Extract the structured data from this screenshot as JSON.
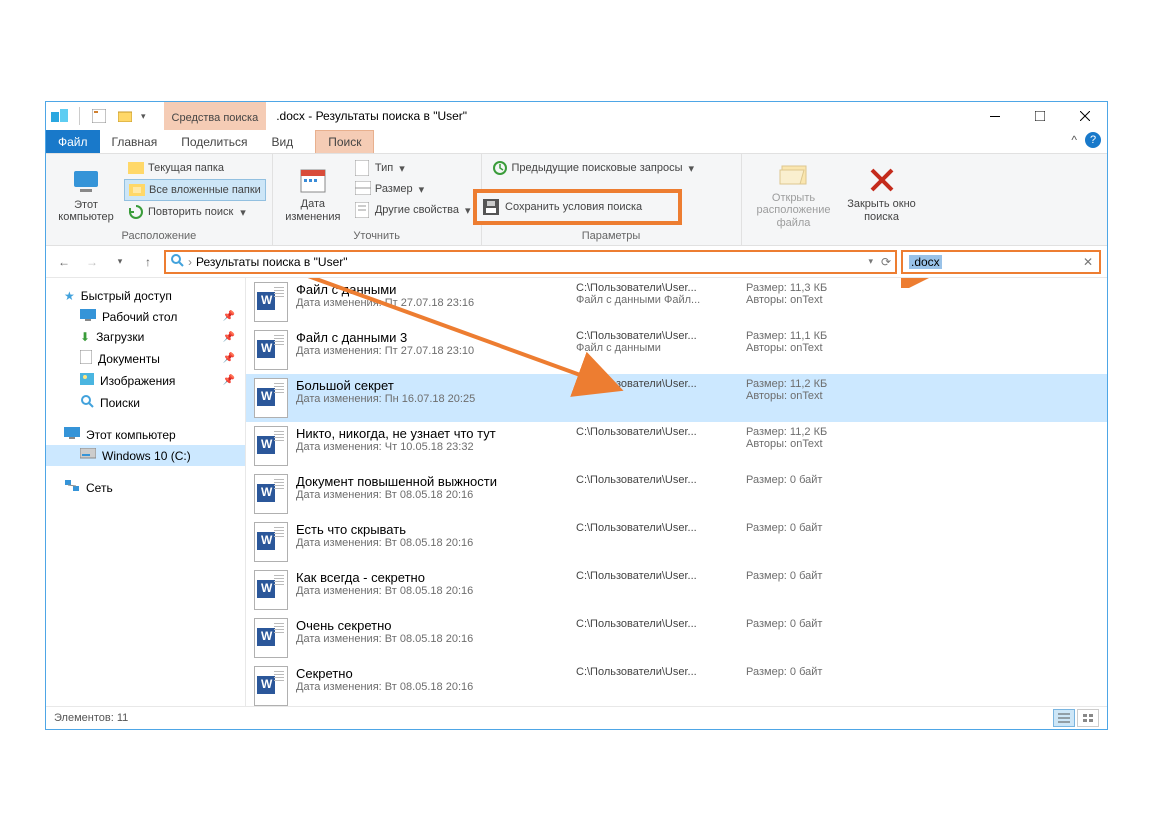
{
  "title_context": "Средства поиска",
  "title": ".docx - Результаты поиска в \"User\"",
  "tabs": {
    "file": "Файл",
    "home": "Главная",
    "share": "Поделиться",
    "view": "Вид",
    "search": "Поиск"
  },
  "ribbon": {
    "location_group": "Расположение",
    "this_pc": "Этот компьютер",
    "current_folder": "Текущая папка",
    "all_subfolders": "Все вложенные папки",
    "search_again": "Повторить поиск",
    "refine_group": "Уточнить",
    "date_modified": "Дата изменения",
    "type": "Тип",
    "size": "Размер",
    "other_props": "Другие свойства",
    "options_group": "Параметры",
    "recent_searches": "Предыдущие поисковые запросы",
    "save_search": "Сохранить условия поиска",
    "open_location": "Открыть расположение файла",
    "close_search": "Закрыть окно поиска"
  },
  "address": "Результаты поиска в \"User\"",
  "search_value": ".docx",
  "sidebar": {
    "quick": "Быстрый доступ",
    "desktop": "Рабочий стол",
    "downloads": "Загрузки",
    "documents": "Документы",
    "pictures": "Изображения",
    "searches": "Поиски",
    "this_pc": "Этот компьютер",
    "drive": "Windows 10 (C:)",
    "network": "Сеть"
  },
  "labels": {
    "date_prefix": "Дата изменения:",
    "size_prefix": "Размер:",
    "authors_prefix": "Авторы:"
  },
  "files": [
    {
      "name": "Файл с данными",
      "date": "Пт 27.07.18 23:16",
      "path": "C:\\Пользователи\\User...",
      "path2": "Файл с данными Файл...",
      "size": "11,3 КБ",
      "authors": "onText"
    },
    {
      "name": "Файл с данными 3",
      "date": "Пт 27.07.18 23:10",
      "path": "C:\\Пользователи\\User...",
      "path2": "Файл с данными",
      "size": "11,1 КБ",
      "authors": "onText"
    },
    {
      "name": "Большой секрет",
      "date": "Пн 16.07.18 20:25",
      "path": "C:\\Пользователи\\User...",
      "path2": "",
      "size": "11,2 КБ",
      "authors": "onText",
      "selected": true
    },
    {
      "name": "Никто, никогда, не узнает что тут",
      "date": "Чт 10.05.18 23:32",
      "path": "C:\\Пользователи\\User...",
      "path2": "",
      "size": "11,2 КБ",
      "authors": "onText"
    },
    {
      "name": "Документ повышенной выжности",
      "date": "Вт 08.05.18 20:16",
      "path": "C:\\Пользователи\\User...",
      "path2": "",
      "size": "0 байт",
      "authors": ""
    },
    {
      "name": "Есть что скрывать",
      "date": "Вт 08.05.18 20:16",
      "path": "C:\\Пользователи\\User...",
      "path2": "",
      "size": "0 байт",
      "authors": ""
    },
    {
      "name": "Как всегда - секретно",
      "date": "Вт 08.05.18 20:16",
      "path": "C:\\Пользователи\\User...",
      "path2": "",
      "size": "0 байт",
      "authors": ""
    },
    {
      "name": "Очень секретно",
      "date": "Вт 08.05.18 20:16",
      "path": "C:\\Пользователи\\User...",
      "path2": "",
      "size": "0 байт",
      "authors": ""
    },
    {
      "name": "Секретно",
      "date": "Вт 08.05.18 20:16",
      "path": "C:\\Пользователи\\User...",
      "path2": "",
      "size": "0 байт",
      "authors": ""
    }
  ],
  "status": "Элементов: 11"
}
